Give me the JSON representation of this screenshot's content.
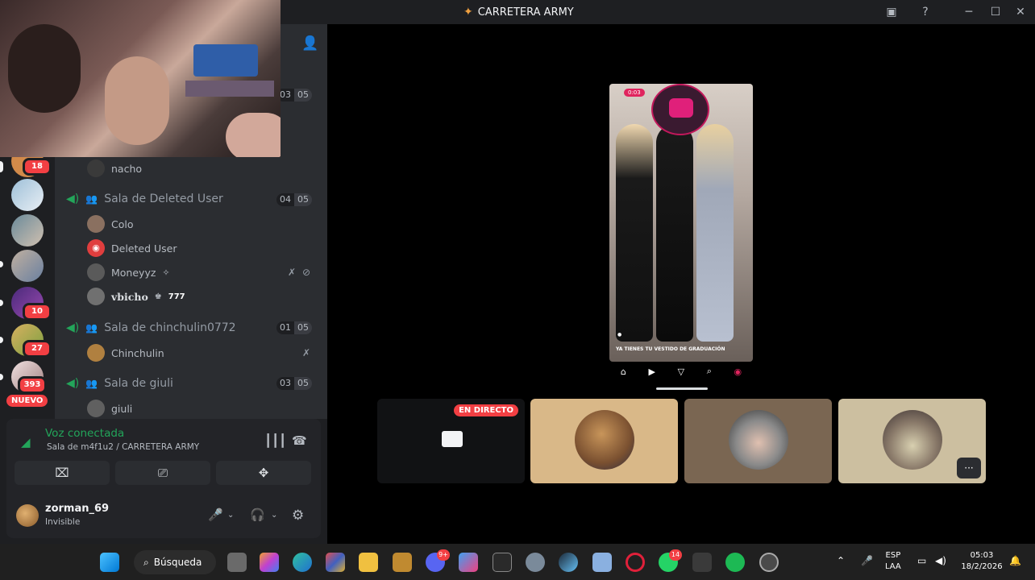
{
  "window": {
    "title": "CARRETERA ARMY"
  },
  "servers": [
    {
      "badge": "18"
    },
    {
      "badge": ""
    },
    {
      "badge": ""
    },
    {
      "badge": ""
    },
    {
      "badge": "10"
    },
    {
      "badge": "27"
    },
    {
      "badge": "393"
    }
  ],
  "new_label": "NUEVO",
  "channels": {
    "top_counts": [
      "03",
      "05"
    ],
    "top_user": "nacho",
    "rooms": [
      {
        "name": "Sala de Deleted User",
        "count": "04",
        "limit": "05"
      },
      {
        "name": "Sala de chinchulin0772",
        "count": "01",
        "limit": "05"
      },
      {
        "name": "Sala de giuli",
        "count": "03",
        "limit": "05"
      }
    ],
    "users_room1": [
      "Colo",
      "Deleted User",
      "Moneyyz",
      "vbicho"
    ],
    "vbicho_tag": "777",
    "users_room2": [
      "Chinchulin"
    ],
    "users_room3": [
      "giuli"
    ]
  },
  "voice": {
    "status": "Voz conectada",
    "location": "Sala de m4f1u2 / CARRETERA ARMY"
  },
  "me": {
    "name": "zorman_69",
    "status": "Invisible"
  },
  "stage": {
    "live_label": "EN DIRECTO",
    "phone_live": "0:03",
    "phone_caption": "YA TIENES TU VESTIDO DE GRADUACIÓN",
    "more_label": "···"
  },
  "taskbar": {
    "search_label": "Búsqueda",
    "discord_badge": "9+",
    "whatsapp_badge": "14",
    "lang_top": "ESP",
    "lang_bottom": "LAA",
    "time": "05:03",
    "date": "18/2/2026"
  }
}
